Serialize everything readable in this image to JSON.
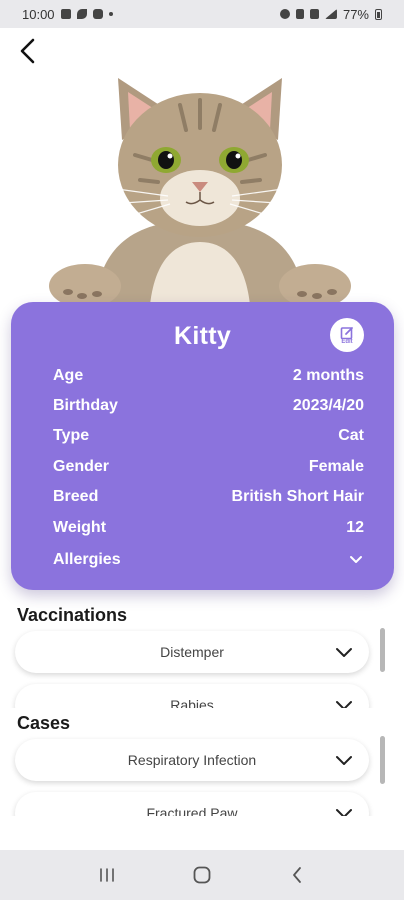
{
  "status_bar": {
    "time": "10:00",
    "battery": "77%"
  },
  "pet": {
    "name": "Kitty",
    "edit_label": "Edit",
    "fields": [
      {
        "label": "Age",
        "value": "2 months"
      },
      {
        "label": "Birthday",
        "value": "2023/4/20"
      },
      {
        "label": "Type",
        "value": "Cat"
      },
      {
        "label": "Gender",
        "value": "Female"
      },
      {
        "label": "Breed",
        "value": "British Short Hair"
      },
      {
        "label": "Weight",
        "value": "12"
      }
    ],
    "allergies_label": "Allergies"
  },
  "vaccinations": {
    "title": "Vaccinations",
    "items": [
      "Distemper",
      "Rabies"
    ]
  },
  "cases": {
    "title": "Cases",
    "items": [
      "Respiratory Infection",
      "Fractured Paw"
    ]
  },
  "icons": {
    "back": "back-arrow-icon",
    "edit": "edit-icon",
    "chevron": "chevron-down-icon",
    "nav_recents": "recents-icon",
    "nav_home": "home-icon",
    "nav_back": "nav-back-icon"
  },
  "colors": {
    "accent": "#8b73dd",
    "background": "#ffffff"
  }
}
